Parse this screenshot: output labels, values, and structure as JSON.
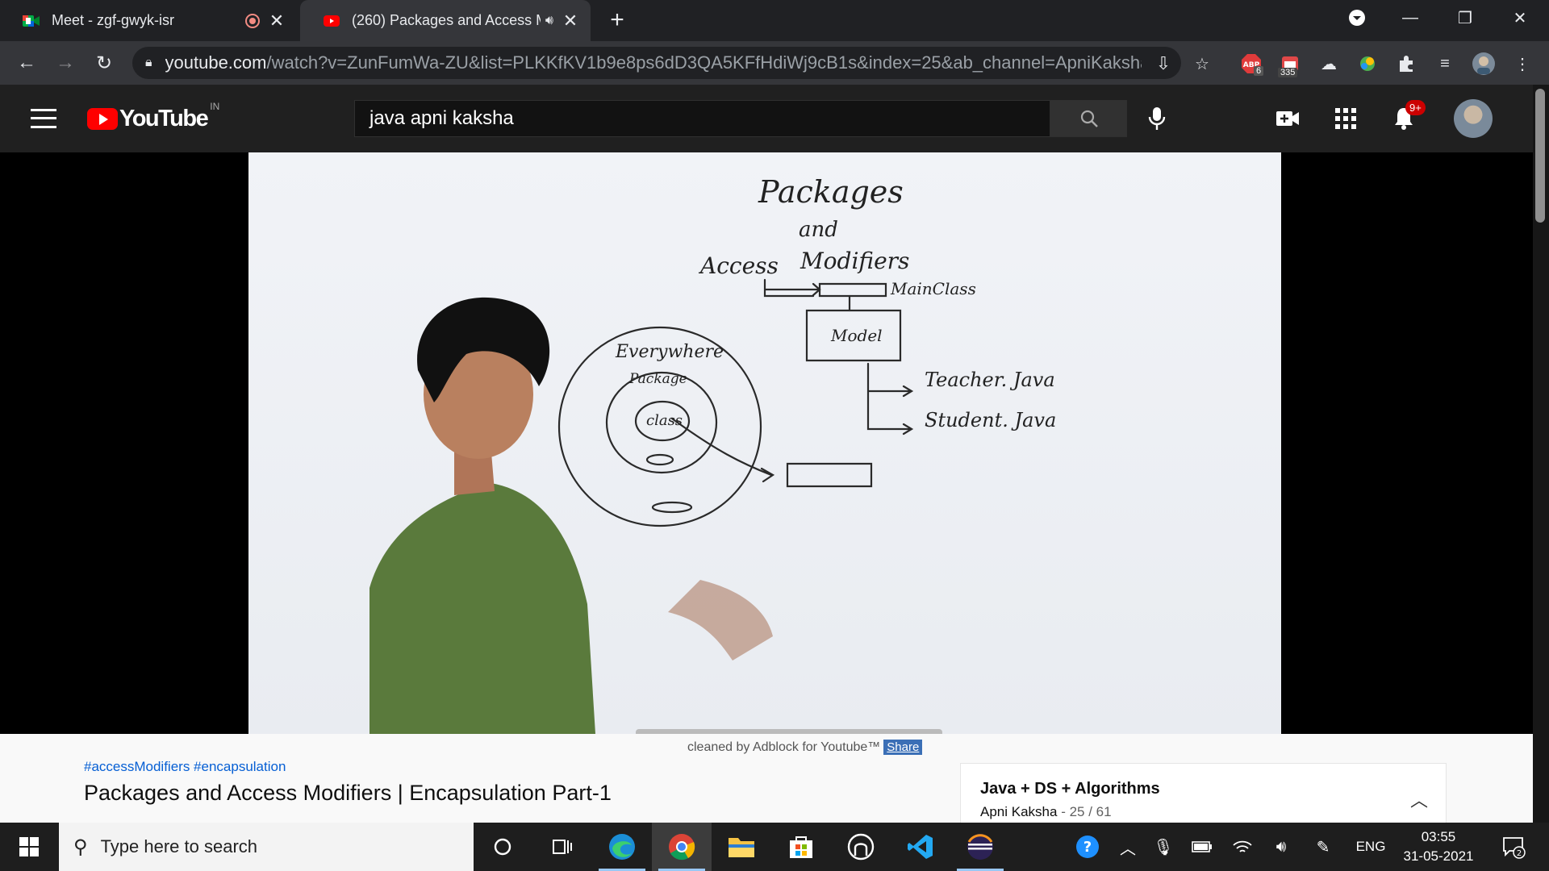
{
  "browser": {
    "tabs": [
      {
        "title": "Meet - zgf-gwyk-isr",
        "active": false
      },
      {
        "title": "(260) Packages and Access M",
        "active": true
      }
    ],
    "url_host": "youtube.com",
    "url_rest": "/watch?v=ZunFumWa-ZU&list=PLKKfKV1b9e8ps6dD3QA5KFfHdiWj9cB1s&index=25&ab_channel=ApniKakshaAp...",
    "extensions": {
      "abp_badge": "6",
      "calendar_badge": "335"
    }
  },
  "youtube": {
    "logo_text": "YouTube",
    "country_code": "IN",
    "search_value": "java apni kaksha",
    "notification_count": "9+"
  },
  "video": {
    "whiteboard": {
      "heading_line1": "Packages",
      "heading_line2": "and",
      "heading_line3a": "Access",
      "heading_line3b": "Modifiers",
      "main_class": "MainClass",
      "model": "Model",
      "teacher": "Teacher. Java",
      "student": "Student. Java",
      "everywhere": "Everywhere",
      "package": "Package",
      "class": "class"
    }
  },
  "below": {
    "adblock_text": "cleaned by Adblock for Youtube™",
    "share_label": "Share",
    "hashtags": "#accessModifiers #encapsulation",
    "video_title": "Packages and Access Modifiers | Encapsulation Part-1",
    "playlist_title": "Java + DS + Algorithms",
    "playlist_channel": "Apni Kaksha",
    "playlist_position": "- 25 / 61"
  },
  "taskbar": {
    "search_placeholder": "Type here to search",
    "language": "ENG",
    "time": "03:55",
    "date": "31-05-2021",
    "notification_count": "2"
  },
  "colors": {
    "chrome_dark": "#202124",
    "chrome_toolbar": "#35363a",
    "youtube_red": "#ff0000",
    "youtube_header": "#202020",
    "link_blue": "#065fd4"
  }
}
